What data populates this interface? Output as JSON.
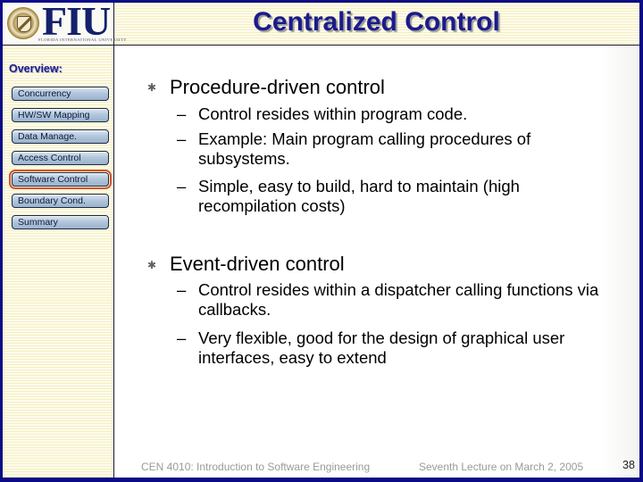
{
  "header": {
    "logo_text": "FIU",
    "logo_subtext": "FLORIDA INTERNATIONAL UNIVERSITY",
    "title": "Centralized Control"
  },
  "sidebar": {
    "heading": "Overview:",
    "items": [
      {
        "label": "Concurrency",
        "active": false
      },
      {
        "label": "HW/SW Mapping",
        "active": false
      },
      {
        "label": "Data Manage.",
        "active": false
      },
      {
        "label": "Access Control",
        "active": false
      },
      {
        "label": "Software Control",
        "active": true
      },
      {
        "label": "Boundary Cond.",
        "active": false
      },
      {
        "label": "Summary",
        "active": false
      }
    ],
    "active_outline_color": "#d4542a"
  },
  "content": {
    "bullets": [
      {
        "text": "Procedure-driven control",
        "sub": [
          "Control resides within program code.",
          "Example: Main program calling procedures of subsystems.",
          "Simple, easy to build, hard to maintain (high recompilation costs)"
        ]
      },
      {
        "text": "Event-driven control",
        "sub": [
          "Control resides within a dispatcher calling functions via callbacks.",
          "Very flexible, good for the design of graphical user interfaces, easy to extend"
        ]
      }
    ],
    "bullet_glyph": "✱",
    "sub_glyph": "–"
  },
  "footer": {
    "course": "CEN 4010: Introduction to Software Engineering",
    "lecture": "Seventh Lecture on March 2, 2005",
    "page_number": "38"
  },
  "colors": {
    "frame": "#0b0b86",
    "title": "#1b1b8c",
    "footer_text": "#9a9a9a"
  }
}
